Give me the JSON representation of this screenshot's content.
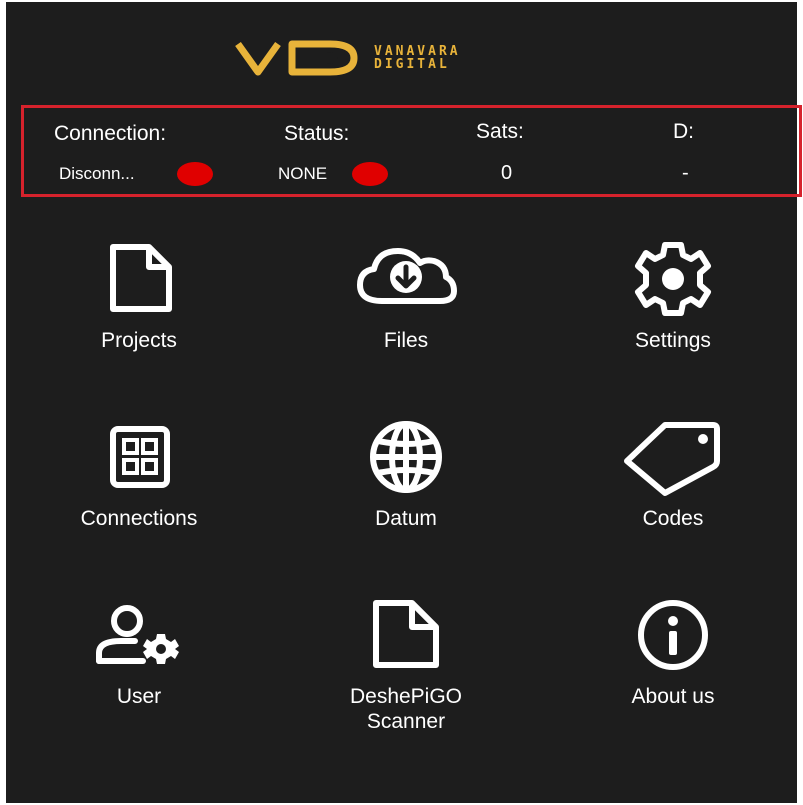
{
  "brand": {
    "mark": "VD",
    "line1": "VANAVARA",
    "line2": "DIGITAL",
    "accent_color": "#e8b33a"
  },
  "status_bar": {
    "connection": {
      "label": "Connection:",
      "value": "Disconn...",
      "indicator_color": "#e00000"
    },
    "status": {
      "label": "Status:",
      "value": "NONE",
      "indicator_color": "#e00000"
    },
    "sats": {
      "label": "Sats:",
      "value": "0"
    },
    "d": {
      "label": "D:",
      "value": "-"
    },
    "border_color": "#d6222c"
  },
  "menu": [
    {
      "label": "Projects",
      "icon": "file-icon"
    },
    {
      "label": "Files",
      "icon": "cloud-download-icon"
    },
    {
      "label": "Settings",
      "icon": "gear-icon"
    },
    {
      "label": "Connections",
      "icon": "grid-panel-icon"
    },
    {
      "label": "Datum",
      "icon": "globe-icon"
    },
    {
      "label": "Codes",
      "icon": "tag-icon"
    },
    {
      "label": "User",
      "icon": "user-settings-icon"
    },
    {
      "label": "DeshePiGO\nScanner",
      "icon": "file-icon"
    },
    {
      "label": "About us",
      "icon": "info-icon"
    }
  ]
}
